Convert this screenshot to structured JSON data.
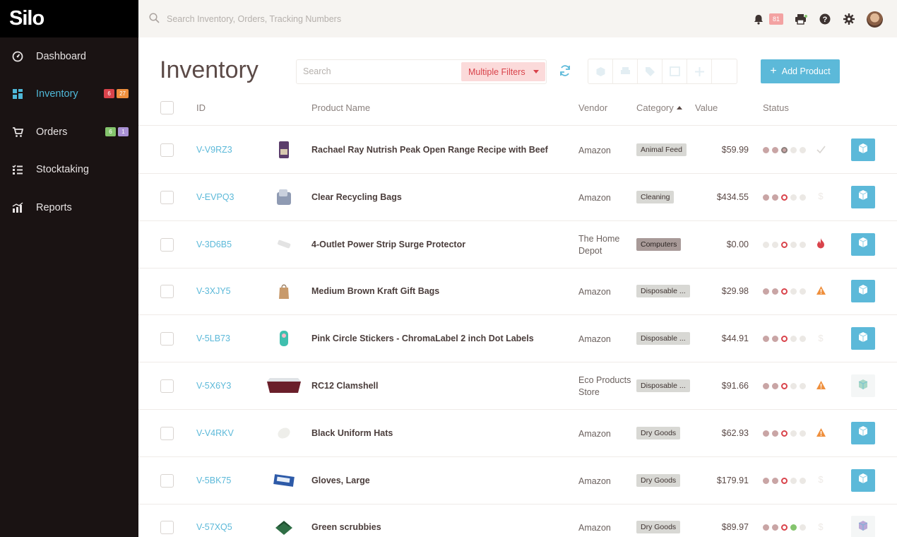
{
  "app": {
    "logo": "Silo"
  },
  "topbar": {
    "search_placeholder": "Search Inventory, Orders, Tracking Numbers",
    "notification_count": "81"
  },
  "sidebar": {
    "items": [
      {
        "label": "Dashboard",
        "icon": "dashboard-icon"
      },
      {
        "label": "Inventory",
        "icon": "grid-icon",
        "badges": [
          "6",
          "27"
        ]
      },
      {
        "label": "Orders",
        "icon": "cart-icon",
        "badges": [
          "6",
          "1"
        ]
      },
      {
        "label": "Stocktaking",
        "icon": "checklist-icon"
      },
      {
        "label": "Reports",
        "icon": "bar-chart-icon"
      }
    ]
  },
  "main": {
    "title": "Inventory",
    "search_placeholder": "Search",
    "filter_label": "Multiple Filters",
    "add_button_label": "Add Product",
    "columns": {
      "id": "ID",
      "product_name": "Product Name",
      "vendor": "Vendor",
      "category": "Category",
      "value": "Value",
      "status": "Status"
    },
    "rows": [
      {
        "id": "V-V9RZ3",
        "name": "Rachael Ray Nutrish Peak Open Range Recipe with Beef",
        "vendor": "Amazon",
        "category": "Animal Feed",
        "value": "$59.99",
        "status_icon": "check-icon"
      },
      {
        "id": "V-EVPQ3",
        "name": "Clear Recycling Bags",
        "vendor": "Amazon",
        "category": "Cleaning",
        "value": "$434.55",
        "status_icon": "dollar-icon"
      },
      {
        "id": "V-3D6B5",
        "name": "4-Outlet Power Strip Surge Protector",
        "vendor": "The Home Depot",
        "category": "Computers",
        "value": "$0.00",
        "status_icon": "fire-icon"
      },
      {
        "id": "V-3XJY5",
        "name": "Medium Brown Kraft Gift Bags",
        "vendor": "Amazon",
        "category": "Disposable ...",
        "value": "$29.98",
        "status_icon": "warning-icon"
      },
      {
        "id": "V-5LB73",
        "name": "Pink Circle Stickers - ChromaLabel 2 inch Dot Labels",
        "vendor": "Amazon",
        "category": "Disposable ...",
        "value": "$44.91",
        "status_icon": "dollar-icon"
      },
      {
        "id": "V-5X6Y3",
        "name": "RC12 Clamshell",
        "vendor": "Eco Products Store",
        "category": "Disposable ...",
        "value": "$91.66",
        "status_icon": "warning-icon"
      },
      {
        "id": "V-V4RKV",
        "name": "Black Uniform Hats",
        "vendor": "Amazon",
        "category": "Dry Goods",
        "value": "$62.93",
        "status_icon": "warning-icon"
      },
      {
        "id": "V-5BK75",
        "name": "Gloves, Large",
        "vendor": "Amazon",
        "category": "Dry Goods",
        "value": "$179.91",
        "status_icon": "dollar-icon"
      },
      {
        "id": "V-57XQ5",
        "name": "Green scrubbies",
        "vendor": "Amazon",
        "category": "Dry Goods",
        "value": "$89.97",
        "status_icon": "dollar-icon"
      }
    ]
  },
  "colors": {
    "accent": "#5cb9d9",
    "sidebar_bg": "#1a1313",
    "danger": "#d9434b",
    "warning": "#ef8f3c"
  }
}
